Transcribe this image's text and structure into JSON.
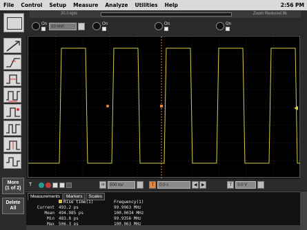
{
  "menu": {
    "items": [
      "File",
      "Control",
      "Setup",
      "Measure",
      "Analyze",
      "Utilities",
      "Help"
    ],
    "clock": "2:56 PM"
  },
  "acquisition": {
    "rate_text": "20.0 kpts",
    "mode_text": "Zoom Reduced 8k"
  },
  "channels": [
    {
      "label": "On",
      "scale": "10 mV/",
      "checked": true
    },
    {
      "label": "On",
      "checked": false
    },
    {
      "label": "On",
      "checked": false
    },
    {
      "label": "On",
      "checked": false
    }
  ],
  "sidebar": {
    "more_label": "More",
    "more_sub": "(1 of 2)",
    "delete_label": "Delete",
    "delete_sub": "All"
  },
  "timebase": {
    "marker": "T",
    "scale": "500 ns/",
    "position": "0.0 s",
    "trigger_marker": "T",
    "trigger_level": "0.0 V"
  },
  "measurements": {
    "tabs": [
      "Measurements",
      "Markers",
      "Scales"
    ],
    "active_tab": "Measurements",
    "headers": [
      "",
      "Rise time(1)",
      "Frequency(1)"
    ],
    "rows": [
      {
        "label": "Current",
        "rise": "493.2 ps",
        "freq": "99.9963 MHz"
      },
      {
        "label": "Mean",
        "rise": "494.985 ps",
        "freq": "100.0034 MHz"
      },
      {
        "label": "Min",
        "rise": "483.8 ps",
        "freq": "99.9356 MHz"
      },
      {
        "label": "Max",
        "rise": "506.3 ps",
        "freq": "100.063 MHz"
      }
    ]
  },
  "colors": {
    "trace": "#d6cf4a",
    "grid": "#5a4a1c",
    "marker": "#e8863a",
    "background": "#000000"
  }
}
